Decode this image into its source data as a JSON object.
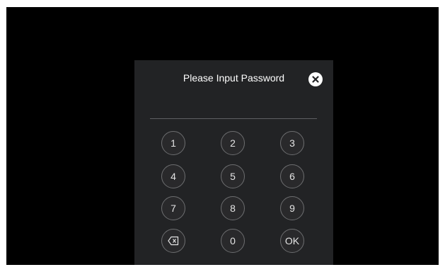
{
  "dialog": {
    "title": "Please Input Password",
    "close_icon": "close-x-circle-icon",
    "password_value": ""
  },
  "keypad": {
    "keys": [
      {
        "label": "1"
      },
      {
        "label": "2"
      },
      {
        "label": "3"
      },
      {
        "label": "4"
      },
      {
        "label": "5"
      },
      {
        "label": "6"
      },
      {
        "label": "7"
      },
      {
        "label": "8"
      },
      {
        "label": "9"
      },
      {
        "icon": "backspace-icon"
      },
      {
        "label": "0"
      },
      {
        "label": "OK"
      }
    ]
  },
  "colors": {
    "background": "#000000",
    "dialog": "#222325",
    "text": "#ffffff",
    "key_border": "#6d6e70"
  }
}
